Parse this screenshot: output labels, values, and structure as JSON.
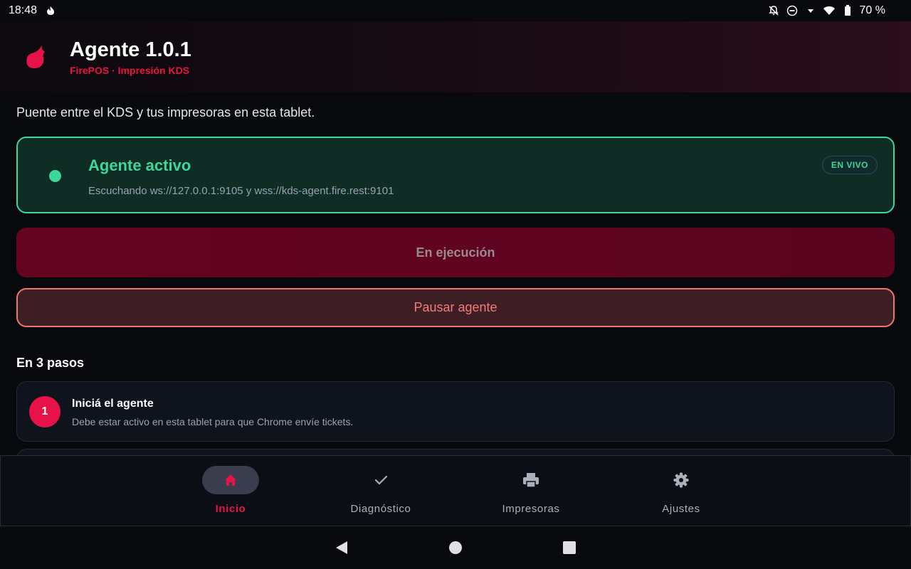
{
  "status_bar": {
    "time": "18:48",
    "battery": "70 %"
  },
  "header": {
    "title": "Agente 1.0.1",
    "subtitle": "FirePOS · Impresión KDS",
    "logo_icon": "flame-logo-icon"
  },
  "tagline": "Puente entre el KDS y tus impresoras en esta tablet.",
  "agent_status": {
    "title": "Agente activo",
    "description": "Escuchando ws://127.0.0.1:9105 y wss://kds-agent.fire.rest:9101",
    "badge": "EN VIVO"
  },
  "buttons": {
    "run_label": "En ejecución",
    "pause_label": "Pausar agente"
  },
  "steps": {
    "title": "En 3 pasos",
    "items": [
      {
        "number": "1",
        "title": "Iniciá el agente",
        "description": "Debe estar activo en esta tablet para que Chrome envíe tickets."
      }
    ]
  },
  "bottom_nav": {
    "items": [
      {
        "label": "Inicio",
        "icon": "home-icon",
        "active": true
      },
      {
        "label": "Diagnóstico",
        "icon": "check-icon",
        "active": false
      },
      {
        "label": "Impresoras",
        "icon": "printer-icon",
        "active": false
      },
      {
        "label": "Ajustes",
        "icon": "gear-icon",
        "active": false
      }
    ]
  },
  "colors": {
    "accent": "#e8124a",
    "active_green": "#3ed69a",
    "pause_red": "#f47c78"
  }
}
